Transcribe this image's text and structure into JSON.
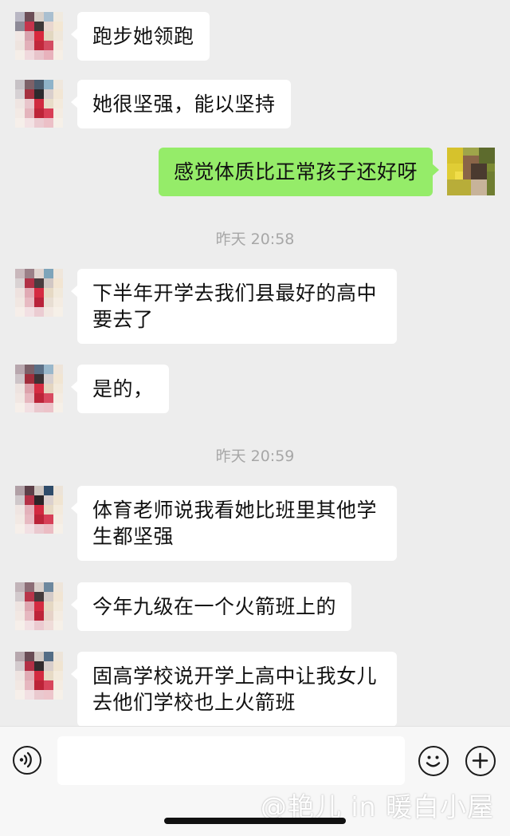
{
  "theme": {
    "background": "#ededed",
    "incoming_bubble": "#ffffff",
    "outgoing_bubble": "#95ec69",
    "timestamp_text": "#a7a7a7"
  },
  "messages": [
    {
      "side": "left",
      "text": "跑步她领跑"
    },
    {
      "side": "left",
      "text": "她很坚强，能以坚持"
    },
    {
      "side": "right",
      "text": "感觉体质比正常孩子还好呀"
    },
    {
      "type": "timestamp",
      "text": "昨天 20:58"
    },
    {
      "side": "left",
      "text": "下半年开学去我们县最好的高中要去了"
    },
    {
      "side": "left",
      "text": "是的，"
    },
    {
      "type": "timestamp",
      "text": "昨天 20:59"
    },
    {
      "side": "left",
      "text": "体育老师说我看她比班里其他学生都坚强"
    },
    {
      "side": "left",
      "text": "今年九级在一个火箭班上的"
    },
    {
      "side": "left",
      "text": "固高学校说开学上高中让我女儿去他们学校也上火箭班"
    }
  ],
  "input_bar": {
    "voice_icon": "voice-wave-icon",
    "text_value": "",
    "emoji_icon": "smiley-icon",
    "plus_icon": "plus-circle-icon"
  },
  "watermark": "@艳儿 in 暖白小屋"
}
